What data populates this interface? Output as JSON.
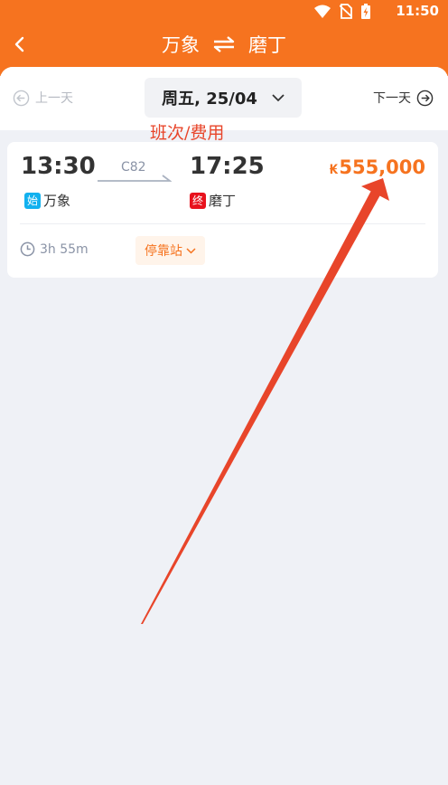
{
  "status_bar": {
    "time": "11:50",
    "icons": [
      "wifi-icon",
      "no-sim-icon",
      "battery-charging-icon"
    ]
  },
  "header": {
    "from": "万象",
    "to": "磨丁",
    "swap_icon": "swap-icon",
    "back_icon": "chevron-left-icon"
  },
  "date_bar": {
    "prev_label": "上一天",
    "date": "周五, 25/04",
    "next_label": "下一天"
  },
  "annotation": {
    "label": "班次/费用",
    "color": "#e8452a"
  },
  "trip": {
    "depart_time": "13:30",
    "arrive_time": "17:25",
    "train_no": "C82",
    "price_currency": "₭",
    "price": "555,000",
    "origin_tag": "始",
    "origin": "万象",
    "dest_tag": "终",
    "destination": "磨丁",
    "duration": "3h 55m",
    "stops_label": "停靠站"
  },
  "colors": {
    "brand": "#f6731f",
    "origin_tag": "#12b1ef",
    "dest_tag": "#e8121d",
    "background": "#eff1f6"
  }
}
